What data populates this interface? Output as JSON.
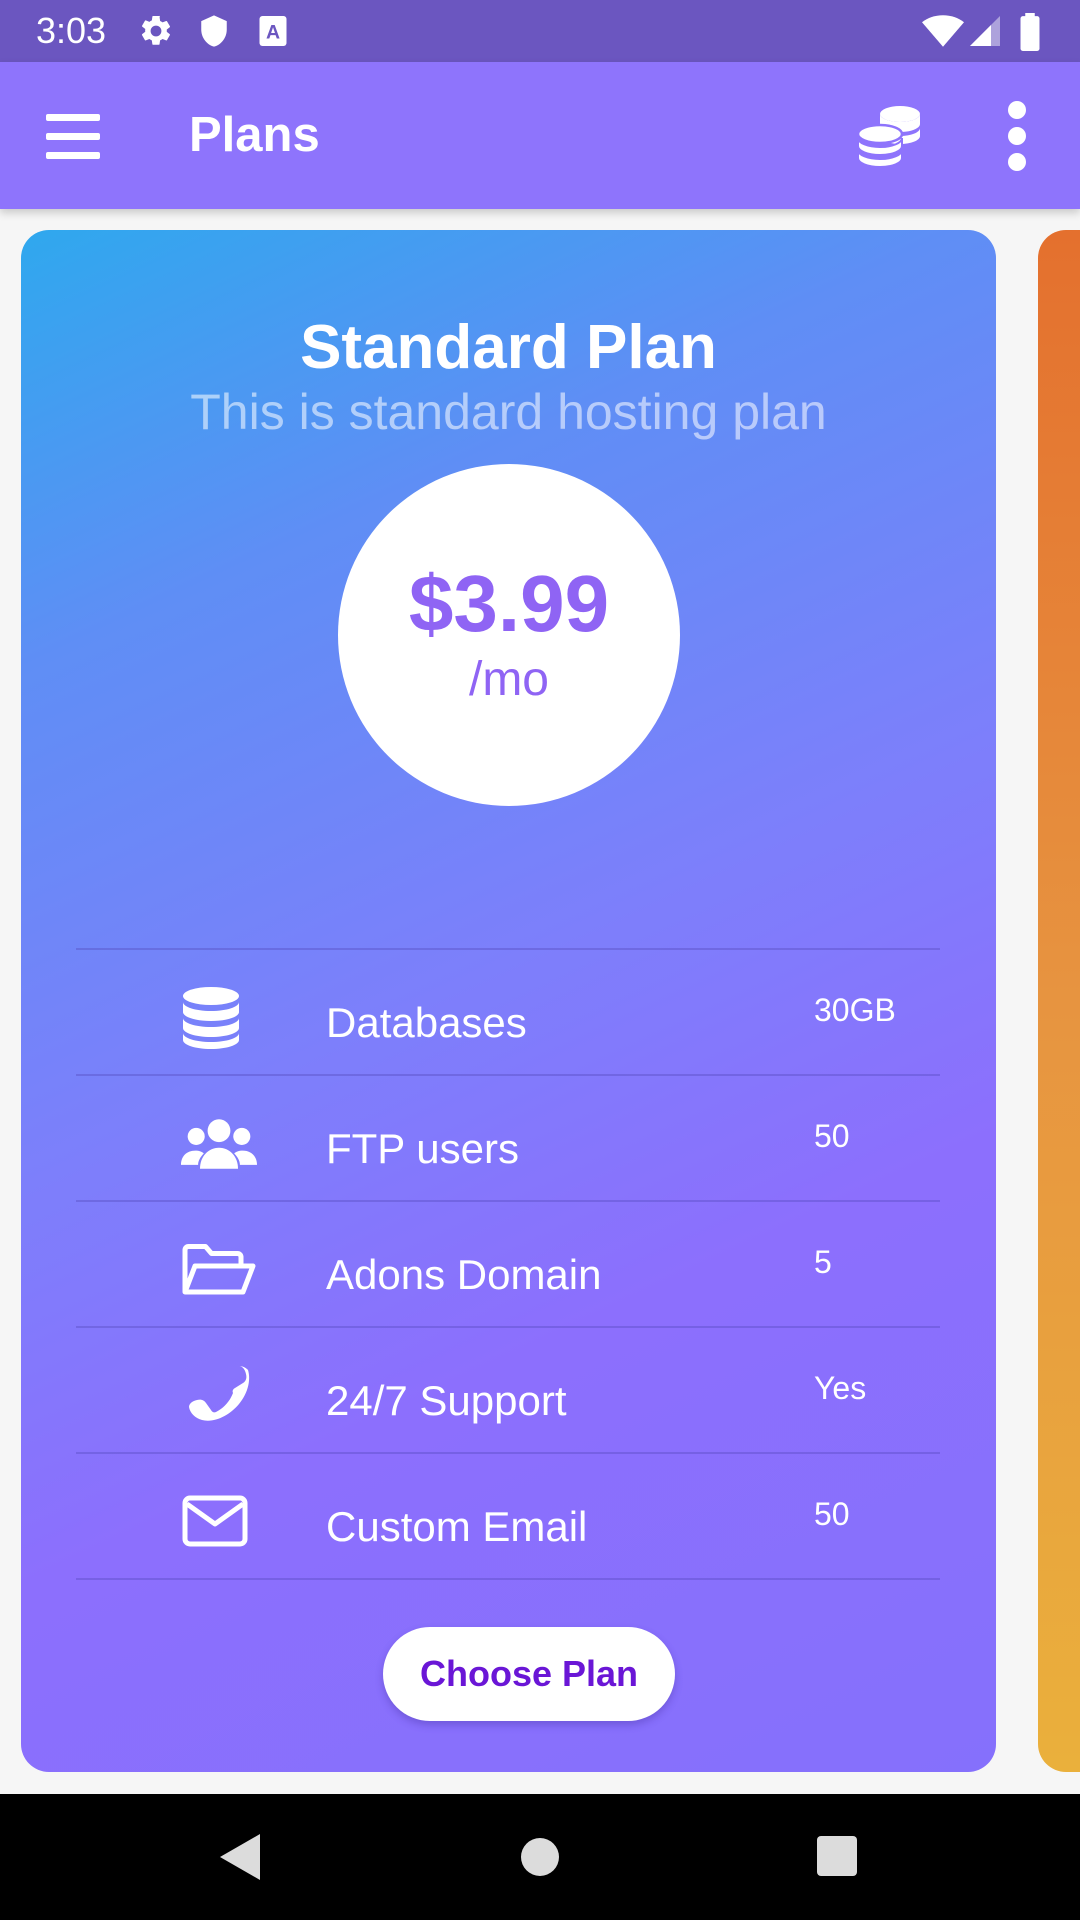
{
  "status_bar": {
    "time": "3:03",
    "icons": [
      "settings-icon",
      "shield-icon",
      "text-a-icon",
      "wifi-icon",
      "signal-icon",
      "battery-icon"
    ]
  },
  "app_bar": {
    "title": "Plans",
    "icons": [
      "menu-icon",
      "coins-icon",
      "more-vertical-icon"
    ]
  },
  "plan": {
    "title": "Standard Plan",
    "subtitle": "This is standard hosting plan",
    "price": "$3.99",
    "period": "/mo",
    "features": [
      {
        "icon": "database-icon",
        "label": "Databases",
        "value": "30GB"
      },
      {
        "icon": "users-icon",
        "label": "FTP users",
        "value": "50"
      },
      {
        "icon": "folder-open-icon",
        "label": "Adons Domain",
        "value": "5"
      },
      {
        "icon": "phone-icon",
        "label": "24/7 Support",
        "value": "Yes"
      },
      {
        "icon": "envelope-icon",
        "label": "Custom Email",
        "value": "50"
      }
    ],
    "button_label": "Choose Plan"
  },
  "colors": {
    "status_bar": "#6b56c0",
    "app_bar": "#8e74fc",
    "card_gradient_start": "#2fa8ee",
    "card_gradient_end": "#8c6ffd",
    "price_text": "#8f64f4",
    "button_text": "#6a16d6",
    "next_card": "#e4702e"
  },
  "nav_bar": {
    "icons": [
      "back-icon",
      "home-icon",
      "recents-icon"
    ]
  }
}
